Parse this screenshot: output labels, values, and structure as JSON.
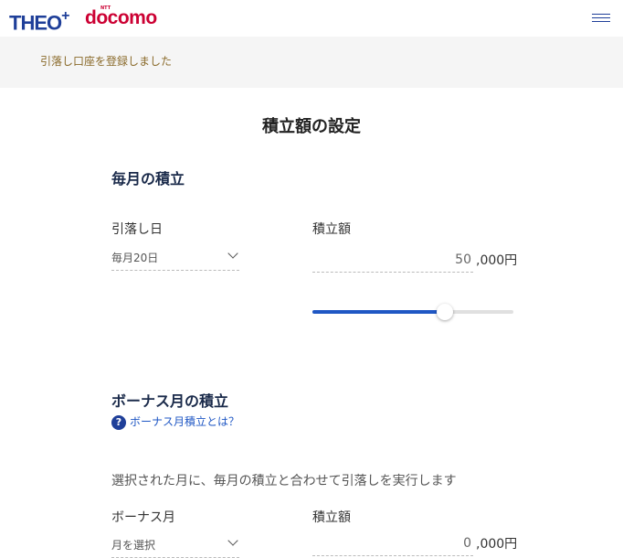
{
  "header": {
    "logo_theo": "THEO",
    "logo_plus": "+",
    "logo_docomo": "docomo",
    "logo_ntt": "NTT",
    "menu_icon": "hamburger-menu-icon"
  },
  "notice": {
    "text": "引落し口座を登録しました"
  },
  "page_title": "積立額の設定",
  "monthly": {
    "title": "毎月の積立",
    "date_label": "引落し日",
    "date_value": "毎月20日",
    "amount_label": "積立額",
    "amount_value": "50",
    "amount_suffix": ",000円",
    "slider_fraction": 0.66
  },
  "bonus": {
    "title": "ボーナス月の積立",
    "help_icon": "question-circle-icon",
    "help_glyph": "?",
    "help_text": "ボーナス月積立とは？",
    "description": "選択された月に、毎月の積立と合わせて引落しを実行します",
    "month_label": "ボーナス月",
    "month_value": "月を選択",
    "amount_label": "積立額",
    "amount_value": "0",
    "amount_suffix": ",000円"
  },
  "colors": {
    "brand_blue": "#1f3f99",
    "docomo_red": "#cc0033",
    "slider_fill": "#1f57c4"
  }
}
